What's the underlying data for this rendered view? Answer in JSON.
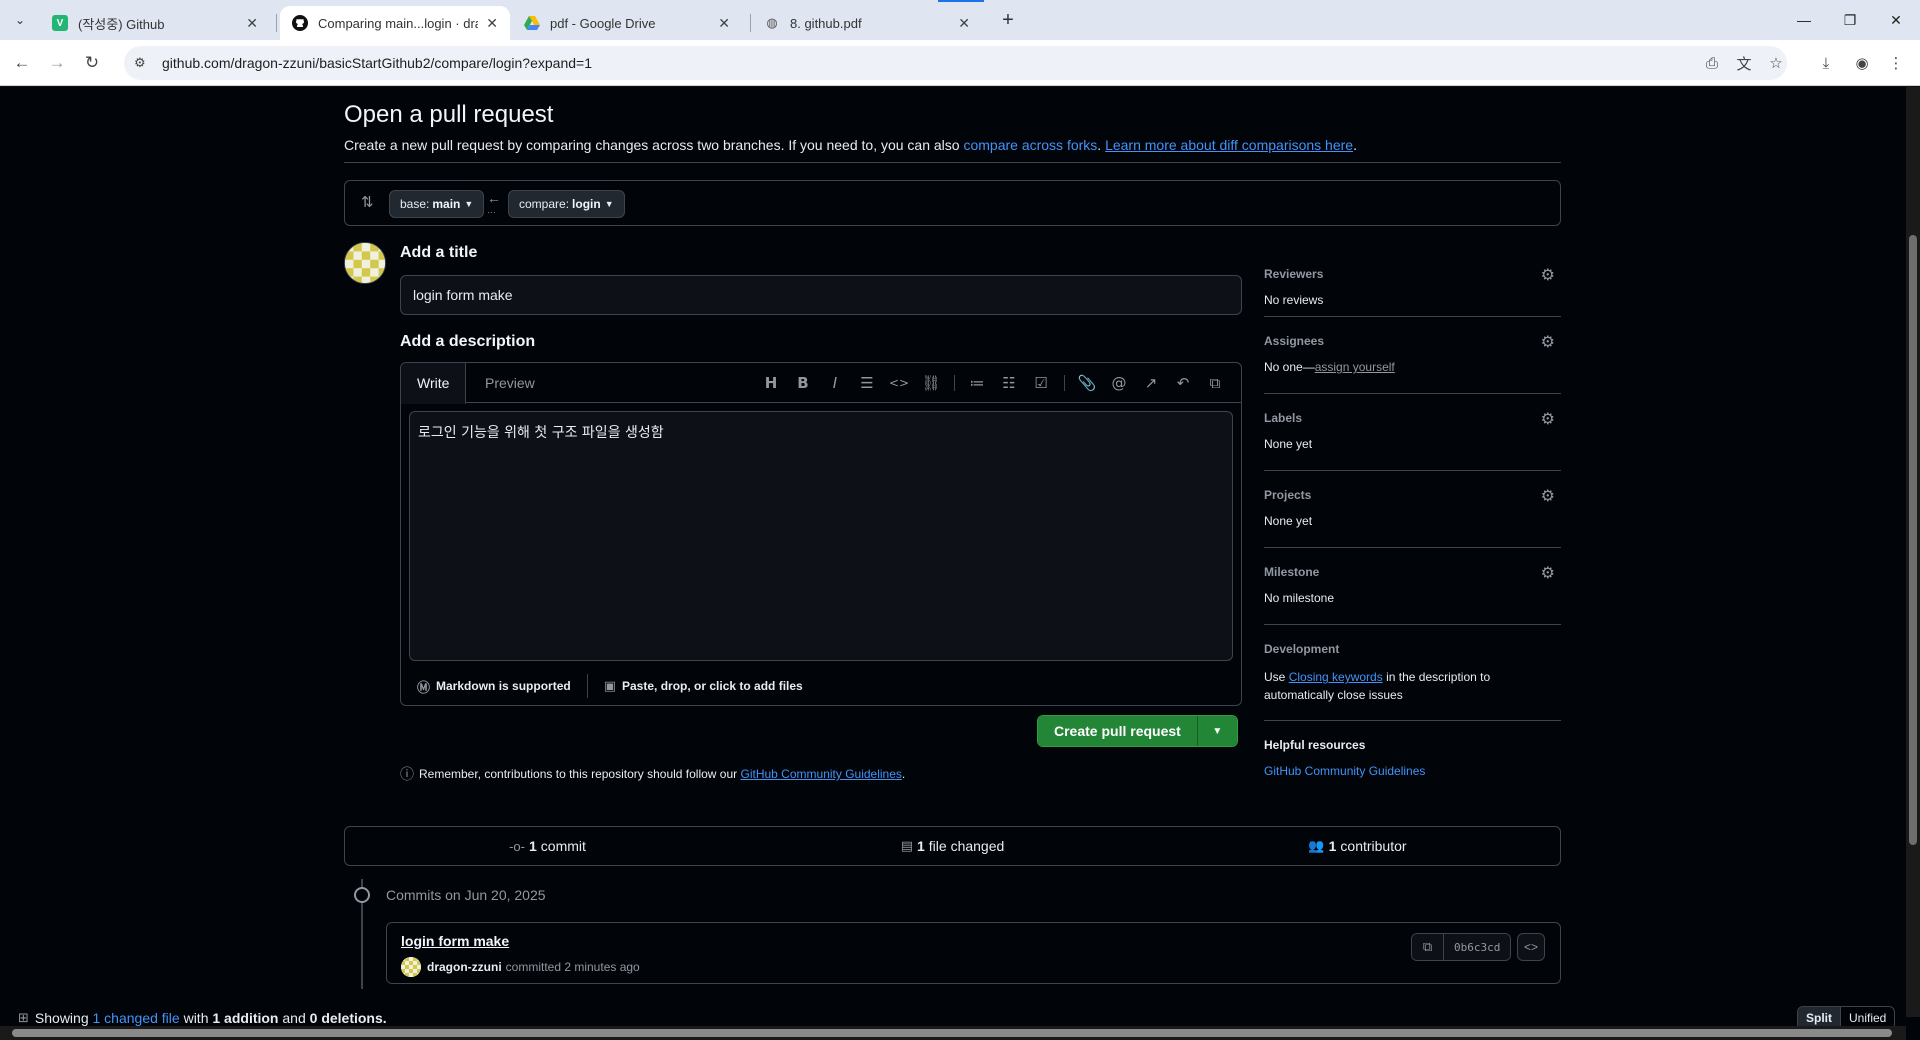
{
  "browser": {
    "tabs": [
      {
        "title": "(작성중) Github",
        "favicon": "V",
        "favicon_color": "#22b573"
      },
      {
        "title": "Comparing main...login · drago",
        "favicon": "github-icon",
        "favicon_color": "#111111"
      },
      {
        "title": "pdf - Google Drive",
        "favicon": "google-drive-icon",
        "favicon_color": "#1a73e8"
      },
      {
        "title": "8. github.pdf",
        "favicon": "globe-icon",
        "favicon_color": "#555555"
      }
    ],
    "active_tab": 1,
    "url": "github.com/dragon-zzuni/basicStartGithub2/compare/login?expand=1"
  },
  "page": {
    "title": "Open a pull request",
    "subtitle_text": "Create a new pull request by comparing changes across two branches. If you need to, you can also",
    "subtitle_link1": "compare across forks",
    "subtitle_link2": "Learn more about diff comparisons here",
    "base_prefix": "base:",
    "base_branch": "main",
    "compare_prefix": "compare:",
    "compare_branch": "login",
    "add_title_label": "Add a title",
    "title_value": "login form make",
    "add_description_label": "Add a description",
    "tab_write": "Write",
    "tab_preview": "Preview",
    "description_value": "로그인 기능을 위해 첫 구조 파일을 생성함",
    "markdown_supported": "Markdown is supported",
    "paste_files": "Paste, drop, or click to add files",
    "create_button": "Create pull request",
    "remember_text": "Remember, contributions to this repository should follow our",
    "guidelines_link": "GitHub Community Guidelines"
  },
  "sidebar": {
    "reviewers_title": "Reviewers",
    "reviewers_value": "No reviews",
    "assignees_title": "Assignees",
    "assignees_value": "No one—",
    "assign_yourself": "assign yourself",
    "labels_title": "Labels",
    "labels_value": "None yet",
    "projects_title": "Projects",
    "projects_value": "None yet",
    "milestone_title": "Milestone",
    "milestone_value": "No milestone",
    "development_title": "Development",
    "development_use": "Use",
    "closing_keywords": "Closing keywords",
    "development_rest": "in the description to automatically close issues",
    "helpful_title": "Helpful resources",
    "helpful_link": "GitHub Community Guidelines"
  },
  "summary": {
    "commit_count": "1",
    "commit_label": "commit",
    "files_count": "1",
    "files_label": "file changed",
    "contributor_count": "1",
    "contributor_label": "contributor"
  },
  "commits": {
    "date_label": "Commits on Jun 20, 2025",
    "items": [
      {
        "title": "login form make",
        "author": "dragon-zzuni",
        "time": "committed 2 minutes ago",
        "sha": "0b6c3cd"
      }
    ]
  },
  "diff": {
    "showing": "Showing",
    "changed_file": "1 changed file",
    "with": "with",
    "additions": "1 addition",
    "and": "and",
    "deletions": "0 deletions.",
    "split": "Split",
    "unified": "Unified"
  },
  "colors": {
    "accent_green": "#238636",
    "link_blue": "#4493f8",
    "bg": "#010409"
  }
}
